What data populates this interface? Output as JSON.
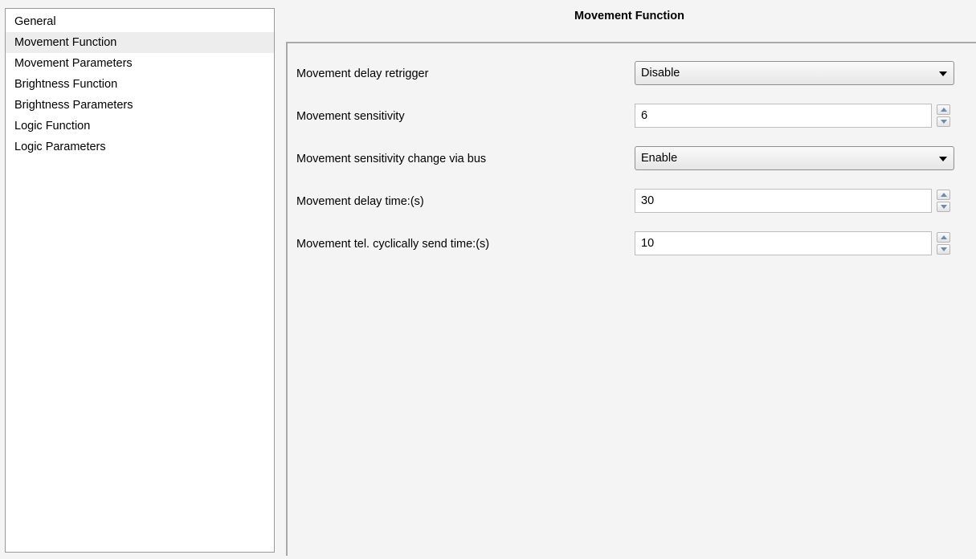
{
  "nav": {
    "items": [
      {
        "label": "General"
      },
      {
        "label": "Movement Function"
      },
      {
        "label": "Movement Parameters"
      },
      {
        "label": "Brightness Function"
      },
      {
        "label": "Brightness Parameters"
      },
      {
        "label": "Logic Function"
      },
      {
        "label": "Logic Parameters"
      }
    ],
    "selected": "Movement Function"
  },
  "page": {
    "title": "Movement Function"
  },
  "params": [
    {
      "label": "Movement delay retrigger",
      "control": "dropdown",
      "value": "Disable",
      "icon": "chevron-down-icon"
    },
    {
      "label": "Movement sensitivity",
      "control": "spinbox",
      "value": "6",
      "icon": "spin-arrows-icon"
    },
    {
      "label": "Movement sensitivity change via bus",
      "control": "dropdown",
      "value": "Enable",
      "icon": "chevron-down-icon"
    },
    {
      "label": "Movement delay time:(s)",
      "control": "spinbox",
      "value": "30",
      "icon": "spin-arrows-icon"
    },
    {
      "label": "Movement tel. cyclically send time:(s)",
      "control": "spinbox",
      "value": "10",
      "icon": "spin-arrows-icon"
    }
  ],
  "colors": {
    "background": "#f4f4f4",
    "selection": "#ededed",
    "spin_arrow": "#6a8bb3"
  }
}
